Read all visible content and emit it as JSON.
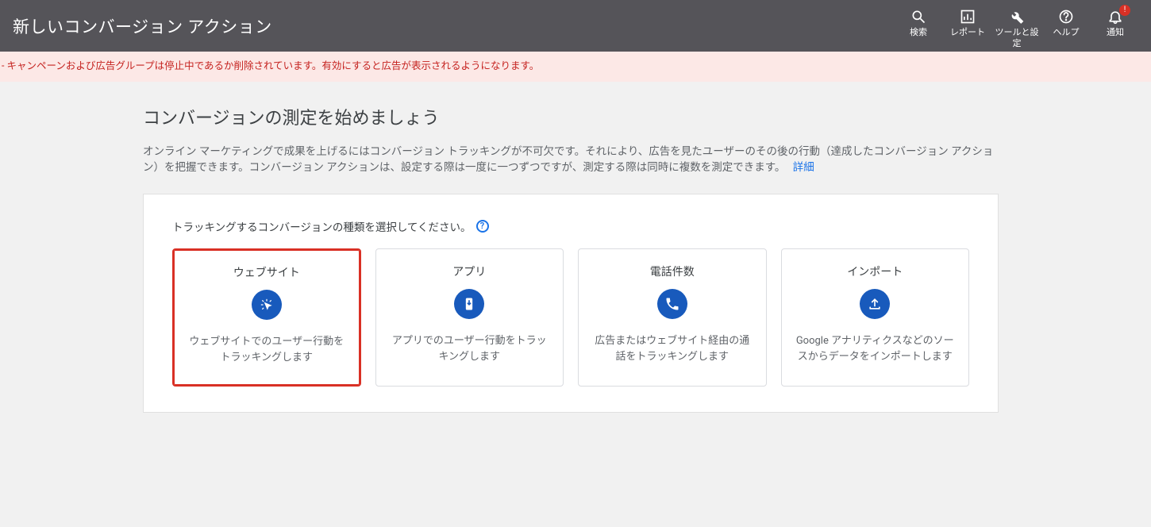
{
  "header": {
    "title": "新しいコンバージョン アクション",
    "actions": {
      "search": "検索",
      "report": "レポート",
      "tools": "ツールと設定",
      "help": "ヘルプ",
      "notifications": "通知",
      "notif_badge": "!"
    }
  },
  "alert": " - キャンペーンおよび広告グループは停止中であるか削除されています。有効にすると広告が表示されるようになります。",
  "main": {
    "heading": "コンバージョンの測定を始めましょう",
    "description": "オンライン マーケティングで成果を上げるにはコンバージョン トラッキングが不可欠です。それにより、広告を見たユーザーのその後の行動（達成したコンバージョン アクション）を把握できます。コンバージョン アクションは、設定する際は一度に一つずつですが、測定する際は同時に複数を測定できます。",
    "detail_link": "詳細",
    "panel_instruction": "トラッキングするコンバージョンの種類を選択してください。",
    "help_glyph": "?",
    "cards": [
      {
        "title": "ウェブサイト",
        "desc": "ウェブサイトでのユーザー行動をトラッキングします"
      },
      {
        "title": "アプリ",
        "desc": "アプリでのユーザー行動をトラッキングします"
      },
      {
        "title": "電話件数",
        "desc": "広告またはウェブサイト経由の通話をトラッキングします"
      },
      {
        "title": "インポート",
        "desc": "Google アナリティクスなどのソースからデータをインポートします"
      }
    ]
  }
}
